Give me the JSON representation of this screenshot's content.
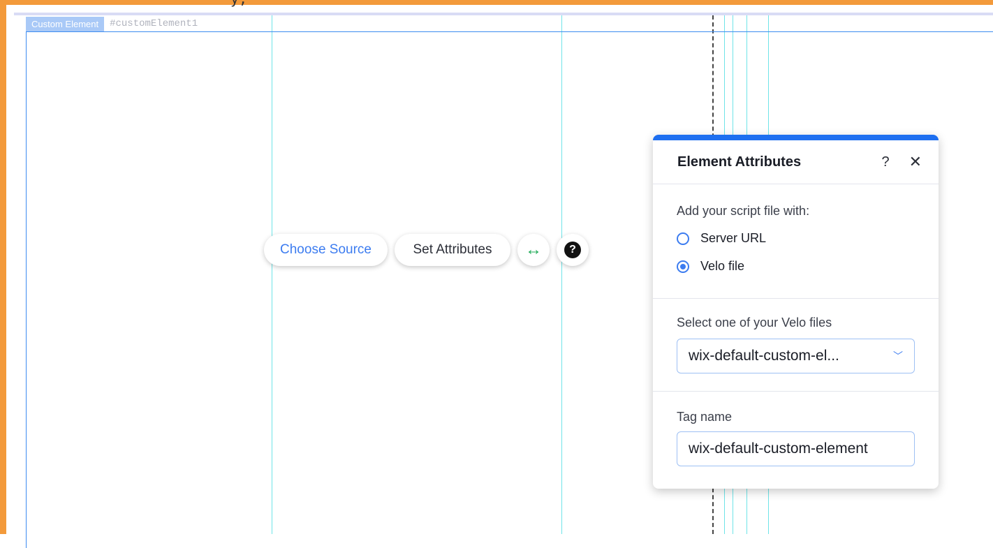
{
  "crop_text": "y,",
  "element": {
    "type_label": "Custom Element",
    "id_label": "#customElement1"
  },
  "actions": {
    "choose_source": "Choose Source",
    "set_attributes": "Set Attributes",
    "stretch_icon": "↔",
    "help_icon": "?"
  },
  "panel": {
    "title": "Element Attributes",
    "help": "?",
    "close": "✕",
    "script_section": {
      "label": "Add your script file with:",
      "options": [
        {
          "label": "Server URL",
          "checked": false
        },
        {
          "label": "Velo file",
          "checked": true
        }
      ]
    },
    "velo_section": {
      "label": "Select one of your Velo files",
      "selected": "wix-default-custom-el..."
    },
    "tag_section": {
      "label": "Tag name",
      "value": "wix-default-custom-element"
    }
  },
  "colors": {
    "frame": "#f39a3b",
    "accent": "#3c7cf0",
    "guide": "#6fe4e8",
    "stretch": "#1eaa56"
  }
}
